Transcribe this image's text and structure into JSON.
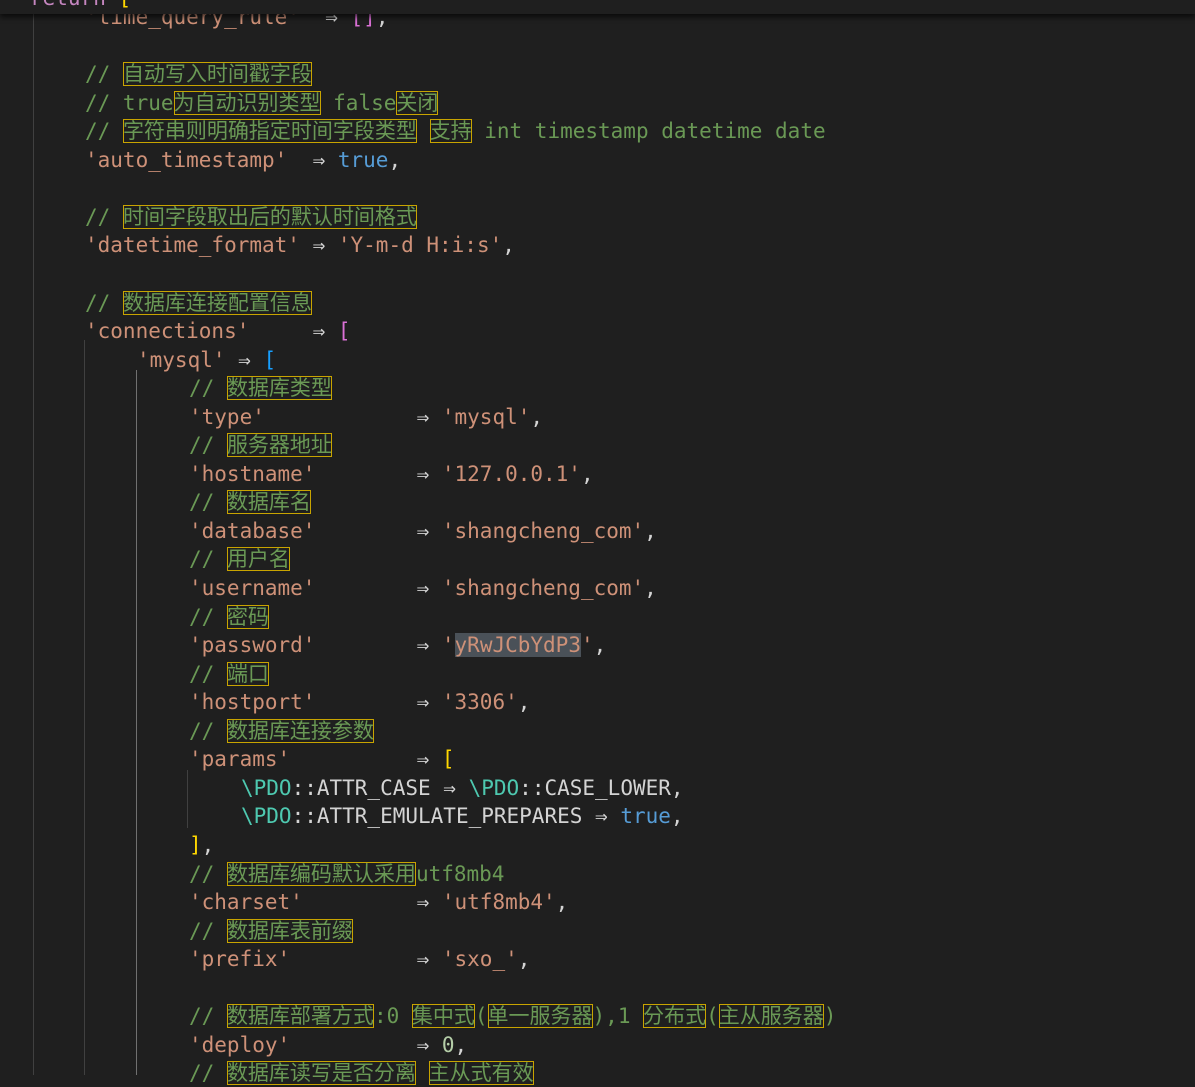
{
  "editor": {
    "sticky_header": {
      "keyword": "return",
      "bracket": "["
    },
    "lines": [
      {
        "indent": 2,
        "tokens": [
          {
            "t": "'time_query_rule'",
            "c": "s"
          },
          {
            "t": "  ⇒ ",
            "c": "p"
          },
          {
            "t": "[]",
            "c": "b2"
          },
          {
            "t": ",",
            "c": "p"
          }
        ]
      },
      {
        "indent": 0,
        "tokens": []
      },
      {
        "indent": 2,
        "tokens": [
          {
            "t": "// ",
            "c": "c"
          },
          {
            "t": "自动写入时间戳字段",
            "c": "c",
            "h": true
          }
        ]
      },
      {
        "indent": 2,
        "tokens": [
          {
            "t": "// true",
            "c": "c"
          },
          {
            "t": "为自动识别类型",
            "c": "c",
            "h": true
          },
          {
            "t": " false",
            "c": "c"
          },
          {
            "t": "关闭",
            "c": "c",
            "h": true
          }
        ]
      },
      {
        "indent": 2,
        "tokens": [
          {
            "t": "// ",
            "c": "c"
          },
          {
            "t": "字符串则明确指定时间字段类型",
            "c": "c",
            "h": true
          },
          {
            "t": " ",
            "c": "c"
          },
          {
            "t": "支持",
            "c": "c",
            "h": true
          },
          {
            "t": " int timestamp datetime date",
            "c": "c"
          }
        ]
      },
      {
        "indent": 2,
        "tokens": [
          {
            "t": "'auto_timestamp'",
            "c": "s"
          },
          {
            "t": "  ⇒ ",
            "c": "p"
          },
          {
            "t": "true",
            "c": "k"
          },
          {
            "t": ",",
            "c": "p"
          }
        ]
      },
      {
        "indent": 0,
        "tokens": []
      },
      {
        "indent": 2,
        "tokens": [
          {
            "t": "// ",
            "c": "c"
          },
          {
            "t": "时间字段取出后的默认时间格式",
            "c": "c",
            "h": true
          }
        ]
      },
      {
        "indent": 2,
        "tokens": [
          {
            "t": "'datetime_format'",
            "c": "s"
          },
          {
            "t": " ⇒ ",
            "c": "p"
          },
          {
            "t": "'Y-m-d H:i:s'",
            "c": "s"
          },
          {
            "t": ",",
            "c": "p"
          }
        ]
      },
      {
        "indent": 0,
        "tokens": []
      },
      {
        "indent": 2,
        "tokens": [
          {
            "t": "// ",
            "c": "c"
          },
          {
            "t": "数据库连接配置信息",
            "c": "c",
            "h": true
          }
        ]
      },
      {
        "indent": 2,
        "tokens": [
          {
            "t": "'connections'",
            "c": "s"
          },
          {
            "t": "     ⇒ ",
            "c": "p"
          },
          {
            "t": "[",
            "c": "b2"
          }
        ]
      },
      {
        "indent": 3,
        "tokens": [
          {
            "t": "'mysql'",
            "c": "s"
          },
          {
            "t": " ⇒ ",
            "c": "p"
          },
          {
            "t": "[",
            "c": "b3"
          }
        ]
      },
      {
        "indent": 4,
        "tokens": [
          {
            "t": "// ",
            "c": "c"
          },
          {
            "t": "数据库类型",
            "c": "c",
            "h": true
          }
        ]
      },
      {
        "indent": 4,
        "tokens": [
          {
            "t": "'type'",
            "c": "s"
          },
          {
            "t": "            ⇒ ",
            "c": "p"
          },
          {
            "t": "'mysql'",
            "c": "s"
          },
          {
            "t": ",",
            "c": "p"
          }
        ]
      },
      {
        "indent": 4,
        "tokens": [
          {
            "t": "// ",
            "c": "c"
          },
          {
            "t": "服务器地址",
            "c": "c",
            "h": true
          }
        ]
      },
      {
        "indent": 4,
        "tokens": [
          {
            "t": "'hostname'",
            "c": "s"
          },
          {
            "t": "        ⇒ ",
            "c": "p"
          },
          {
            "t": "'127.0.0.1'",
            "c": "s"
          },
          {
            "t": ",",
            "c": "p"
          }
        ]
      },
      {
        "indent": 4,
        "tokens": [
          {
            "t": "// ",
            "c": "c"
          },
          {
            "t": "数据库名",
            "c": "c",
            "h": true
          }
        ]
      },
      {
        "indent": 4,
        "tokens": [
          {
            "t": "'database'",
            "c": "s"
          },
          {
            "t": "        ⇒ ",
            "c": "p"
          },
          {
            "t": "'shangcheng_com'",
            "c": "s"
          },
          {
            "t": ",",
            "c": "p"
          }
        ]
      },
      {
        "indent": 4,
        "tokens": [
          {
            "t": "// ",
            "c": "c"
          },
          {
            "t": "用户名",
            "c": "c",
            "h": true
          }
        ]
      },
      {
        "indent": 4,
        "tokens": [
          {
            "t": "'username'",
            "c": "s"
          },
          {
            "t": "        ⇒ ",
            "c": "p"
          },
          {
            "t": "'shangcheng_com'",
            "c": "s"
          },
          {
            "t": ",",
            "c": "p"
          }
        ]
      },
      {
        "indent": 4,
        "tokens": [
          {
            "t": "// ",
            "c": "c"
          },
          {
            "t": "密码",
            "c": "c",
            "h": true
          }
        ]
      },
      {
        "indent": 4,
        "tokens": [
          {
            "t": "'password'",
            "c": "s"
          },
          {
            "t": "        ⇒ ",
            "c": "p"
          },
          {
            "t": "'",
            "c": "s"
          },
          {
            "t": "yRwJCbYdP3",
            "c": "s",
            "sel": true
          },
          {
            "t": "'",
            "c": "s"
          },
          {
            "t": ",",
            "c": "p"
          }
        ]
      },
      {
        "indent": 4,
        "tokens": [
          {
            "t": "// ",
            "c": "c"
          },
          {
            "t": "端口",
            "c": "c",
            "h": true
          }
        ]
      },
      {
        "indent": 4,
        "tokens": [
          {
            "t": "'hostport'",
            "c": "s"
          },
          {
            "t": "        ⇒ ",
            "c": "p"
          },
          {
            "t": "'3306'",
            "c": "s"
          },
          {
            "t": ",",
            "c": "p"
          }
        ]
      },
      {
        "indent": 4,
        "tokens": [
          {
            "t": "// ",
            "c": "c"
          },
          {
            "t": "数据库连接参数",
            "c": "c",
            "h": true
          }
        ]
      },
      {
        "indent": 4,
        "tokens": [
          {
            "t": "'params'",
            "c": "s"
          },
          {
            "t": "          ⇒ ",
            "c": "p"
          },
          {
            "t": "[",
            "c": "b1"
          }
        ]
      },
      {
        "indent": 5,
        "tokens": [
          {
            "t": "\\PDO",
            "c": "cls"
          },
          {
            "t": "::ATTR_CASE",
            "c": "p"
          },
          {
            "t": " ⇒ ",
            "c": "p"
          },
          {
            "t": "\\PDO",
            "c": "cls"
          },
          {
            "t": "::CASE_LOWER",
            "c": "p"
          },
          {
            "t": ",",
            "c": "p"
          }
        ]
      },
      {
        "indent": 5,
        "tokens": [
          {
            "t": "\\PDO",
            "c": "cls"
          },
          {
            "t": "::ATTR_EMULATE_PREPARES",
            "c": "p"
          },
          {
            "t": " ⇒ ",
            "c": "p"
          },
          {
            "t": "true",
            "c": "k"
          },
          {
            "t": ",",
            "c": "p"
          }
        ]
      },
      {
        "indent": 4,
        "tokens": [
          {
            "t": "]",
            "c": "b1"
          },
          {
            "t": ",",
            "c": "p"
          }
        ]
      },
      {
        "indent": 4,
        "tokens": [
          {
            "t": "// ",
            "c": "c"
          },
          {
            "t": "数据库编码默认采用",
            "c": "c",
            "h": true
          },
          {
            "t": "utf8mb4",
            "c": "c"
          }
        ]
      },
      {
        "indent": 4,
        "tokens": [
          {
            "t": "'charset'",
            "c": "s"
          },
          {
            "t": "         ⇒ ",
            "c": "p"
          },
          {
            "t": "'utf8mb4'",
            "c": "s"
          },
          {
            "t": ",",
            "c": "p"
          }
        ]
      },
      {
        "indent": 4,
        "tokens": [
          {
            "t": "// ",
            "c": "c"
          },
          {
            "t": "数据库表前缀",
            "c": "c",
            "h": true
          }
        ]
      },
      {
        "indent": 4,
        "tokens": [
          {
            "t": "'prefix'",
            "c": "s"
          },
          {
            "t": "          ⇒ ",
            "c": "p"
          },
          {
            "t": "'sxo_'",
            "c": "s"
          },
          {
            "t": ",",
            "c": "p"
          }
        ]
      },
      {
        "indent": 0,
        "tokens": []
      },
      {
        "indent": 4,
        "tokens": [
          {
            "t": "// ",
            "c": "c"
          },
          {
            "t": "数据库部署方式",
            "c": "c",
            "h": true
          },
          {
            "t": ":0 ",
            "c": "c"
          },
          {
            "t": "集中式",
            "c": "c",
            "h": true
          },
          {
            "t": "(",
            "c": "c"
          },
          {
            "t": "单一服务器",
            "c": "c",
            "h": true
          },
          {
            "t": "),1 ",
            "c": "c"
          },
          {
            "t": "分布式",
            "c": "c",
            "h": true
          },
          {
            "t": "(",
            "c": "c"
          },
          {
            "t": "主从服务器",
            "c": "c",
            "h": true
          },
          {
            "t": ")",
            "c": "c"
          }
        ]
      },
      {
        "indent": 4,
        "tokens": [
          {
            "t": "'deploy'",
            "c": "s"
          },
          {
            "t": "          ⇒ ",
            "c": "p"
          },
          {
            "t": "0",
            "c": "n"
          },
          {
            "t": ",",
            "c": "p"
          }
        ]
      },
      {
        "indent": 4,
        "tokens": [
          {
            "t": "// ",
            "c": "c"
          },
          {
            "t": "数据库读写是否分离",
            "c": "c",
            "h": true
          },
          {
            "t": " ",
            "c": "c"
          },
          {
            "t": "主从式有效",
            "c": "c",
            "h": true
          }
        ]
      }
    ]
  }
}
